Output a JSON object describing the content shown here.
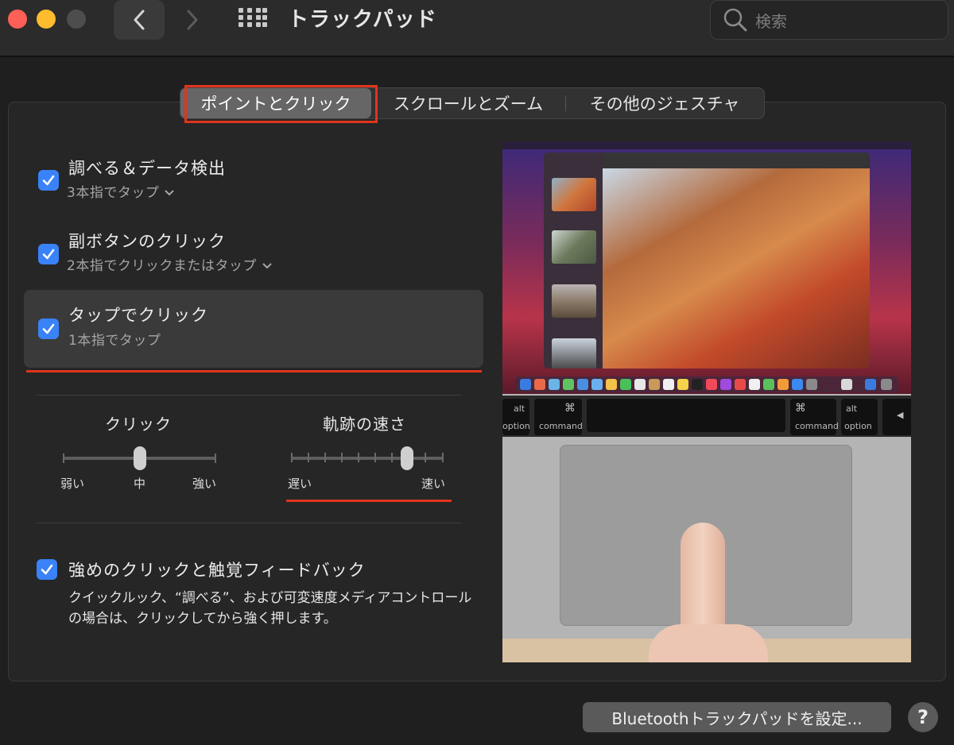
{
  "window": {
    "title": "トラックパッド",
    "search_placeholder": "検索"
  },
  "tabs": [
    {
      "label": "ポイントとクリック",
      "selected": true
    },
    {
      "label": "スクロールとズーム",
      "selected": false
    },
    {
      "label": "その他のジェスチャ",
      "selected": false
    }
  ],
  "options": {
    "lookup": {
      "title": "調べる＆データ検出",
      "detail": "3本指でタップ",
      "checked": true
    },
    "secondary_click": {
      "title": "副ボタンのクリック",
      "detail": "2本指でクリックまたはタップ",
      "checked": true
    },
    "tap_to_click": {
      "title": "タップでクリック",
      "detail": "1本指でタップ",
      "checked": true
    },
    "force_click": {
      "title": "強めのクリックと触覚フィードバック",
      "description": "クイックルック、“調べる”、および可変速度メディアコントロールの場合は、クリックしてから強く押します。",
      "checked": true
    }
  },
  "sliders": {
    "click": {
      "label": "クリック",
      "min_label": "弱い",
      "mid_label": "中",
      "max_label": "強い",
      "value": 0.5
    },
    "tracking": {
      "label": "軌跡の速さ",
      "min_label": "遅い",
      "max_label": "速い",
      "value": 0.78
    }
  },
  "preview_keys": {
    "alt": "alt",
    "option": "option",
    "command": "command",
    "cmd_symbol": "⌘"
  },
  "bottom": {
    "bluetooth_button": "Bluetoothトラックパッドを設定...",
    "help_label": "?"
  },
  "colors": {
    "accent": "#3a82f7",
    "annotation_red": "#e0341e"
  }
}
